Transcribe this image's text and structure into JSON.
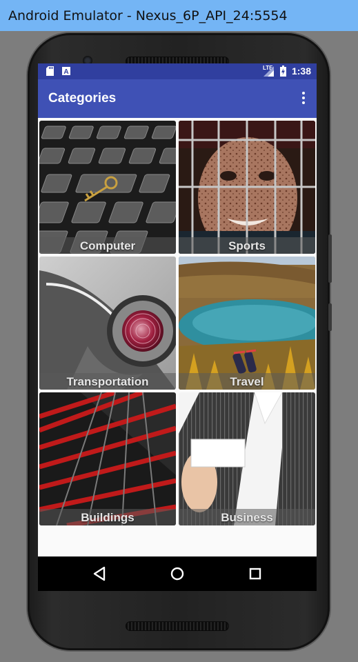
{
  "window": {
    "title": "Android Emulator - Nexus_6P_API_24:5554"
  },
  "status_bar": {
    "time": "1:38",
    "network": "LTE",
    "notification_icons": [
      "sd-card-icon",
      "text-a-icon"
    ]
  },
  "app_bar": {
    "title": "Categories",
    "overflow_icon": "more-vert-icon"
  },
  "categories": [
    {
      "label": "Computer"
    },
    {
      "label": "Sports"
    },
    {
      "label": "Transportation"
    },
    {
      "label": "Travel"
    },
    {
      "label": "Buildings"
    },
    {
      "label": "Business"
    }
  ],
  "nav_bar": {
    "buttons": [
      "back-icon",
      "home-icon",
      "recents-icon"
    ]
  },
  "colors": {
    "status_bar": "#303f9f",
    "app_bar": "#3f51b5",
    "title_bar": "#74b5f5"
  }
}
